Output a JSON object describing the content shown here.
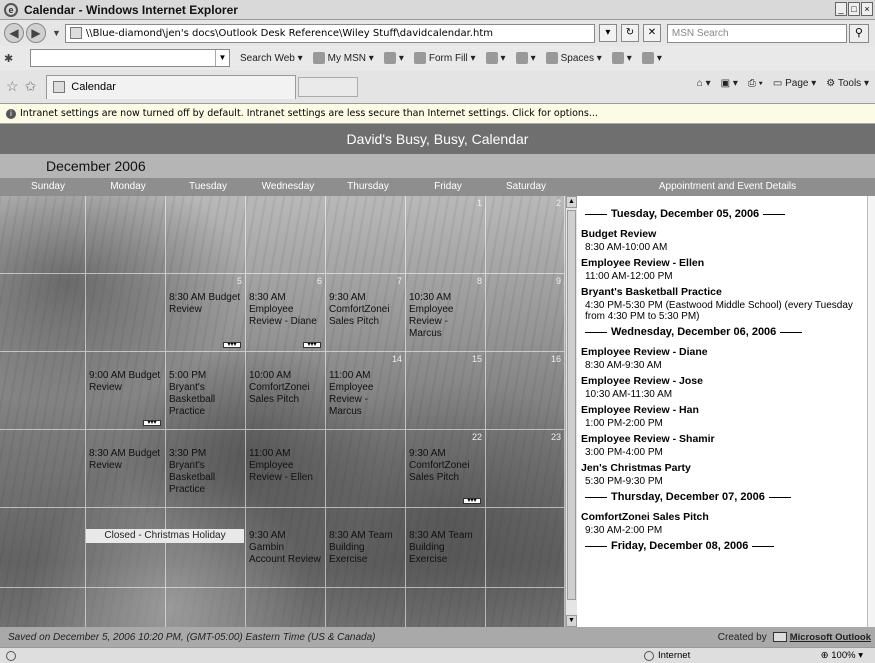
{
  "window": {
    "title": "Calendar - Windows Internet Explorer"
  },
  "address": {
    "url": "\\\\Blue-diamond\\jen's docs\\Outlook Desk Reference\\Wiley Stuff\\davidcalendar.htm",
    "search_placeholder": "MSN Search"
  },
  "msn_toolbar": {
    "items": [
      "Search Web",
      "My MSN",
      "Form Fill",
      "Spaces"
    ]
  },
  "tab": {
    "label": "Calendar",
    "commands": [
      "Page",
      "Tools"
    ]
  },
  "infobar": {
    "text": "Intranet settings are now turned off by default. Intranet settings are less secure than Internet settings. Click for options..."
  },
  "calendar": {
    "title": "David's Busy, Busy, Calendar",
    "month": "December 2006",
    "weekdays": [
      "Sunday",
      "Monday",
      "Tuesday",
      "Wednesday",
      "Thursday",
      "Friday",
      "Saturday"
    ],
    "details_header": "Appointment and Event Details",
    "day_numbers": {
      "d1": "1",
      "d2": "2",
      "d5": "5",
      "d6": "6",
      "d7": "7",
      "d8": "8",
      "d9": "9",
      "d14": "14",
      "d15": "15",
      "d16": "16",
      "d22": "22",
      "d23": "23"
    },
    "events": {
      "d5": "8:30 AM Budget Review",
      "d6": "8:30 AM Employee Review - Diane",
      "d7": "9:30 AM ComfortZonei Sales Pitch",
      "d8": "10:30 AM Employee Review - Marcus",
      "d11": "9:00 AM Budget Review",
      "d12": "5:00 PM Bryant's Basketball Practice",
      "d13": "10:00 AM ComfortZonei Sales Pitch",
      "d14": "11:00 AM Employee Review - Marcus",
      "d18": "8:30 AM Budget Review",
      "d19": "3:30 PM Bryant's Basketball Practice",
      "d20": "11:00 AM Employee Review - Ellen",
      "d22": "9:30 AM ComfortZonei Sales Pitch",
      "d27": "9:30 AM Gambin Account Review",
      "d28": "8:30 AM Team Building Exercise",
      "d29": "8:30 AM Team Building Exercise"
    },
    "holiday": "Closed - Christmas Holiday"
  },
  "details": {
    "days": [
      {
        "heading": "Tuesday, December 05, 2006",
        "items": [
          {
            "title": "Budget Review",
            "time": "8:30 AM-10:00 AM"
          },
          {
            "title": "Employee Review - Ellen",
            "time": "11:00 AM-12:00 PM"
          },
          {
            "title": "Bryant's Basketball Practice",
            "time": "4:30 PM-5:30 PM (Eastwood Middle School) (every Tuesday from 4:30 PM to 5:30 PM)"
          }
        ]
      },
      {
        "heading": "Wednesday, December 06, 2006",
        "items": [
          {
            "title": "Employee Review - Diane",
            "time": "8:30 AM-9:30 AM"
          },
          {
            "title": "Employee Review - Jose",
            "time": "10:30 AM-11:30 AM"
          },
          {
            "title": "Employee Review - Han",
            "time": "1:00 PM-2:00 PM"
          },
          {
            "title": "Employee Review - Shamir",
            "time": "3:00 PM-4:00 PM"
          },
          {
            "title": "Jen's Christmas Party",
            "time": "5:30 PM-9:30 PM"
          }
        ]
      },
      {
        "heading": "Thursday, December 07, 2006",
        "items": [
          {
            "title": "ComfortZonei Sales Pitch",
            "time": "9:30 AM-2:00 PM"
          }
        ]
      },
      {
        "heading": "Friday, December 08, 2006",
        "items": []
      }
    ]
  },
  "footer": {
    "saved": "Saved on December 5, 2006 10:20 PM, (GMT-05:00) Eastern Time (US & Canada)",
    "created_by": "Created by",
    "outlook": "Microsoft Outlook"
  },
  "statusbar": {
    "zone": "Internet",
    "zoom": "100%"
  }
}
